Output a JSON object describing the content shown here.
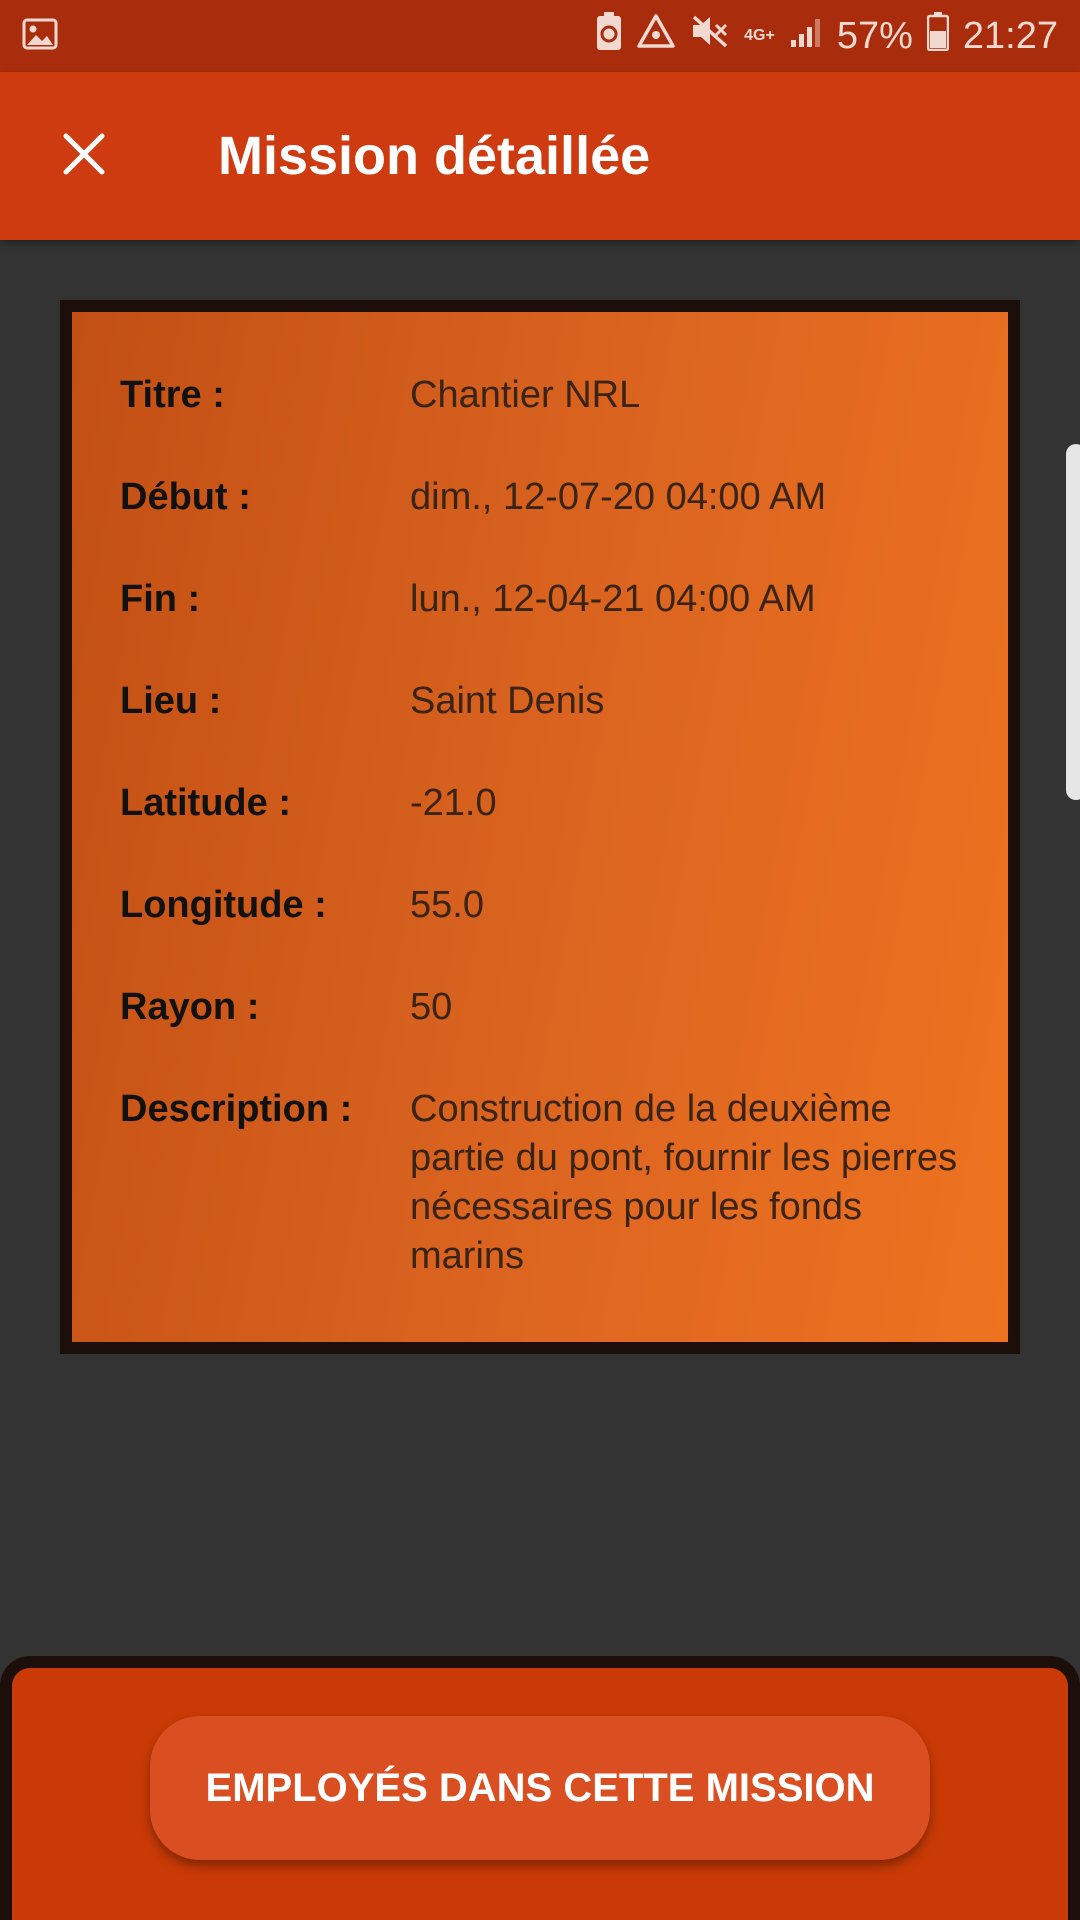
{
  "status_bar": {
    "left_icon": "gallery-icon",
    "network": "4G+",
    "battery_percent": "57%",
    "time": "21:27"
  },
  "app_bar": {
    "title": "Mission détaillée",
    "close_icon": "close-icon"
  },
  "mission": {
    "fields": [
      {
        "label": "Titre :",
        "value": "Chantier NRL"
      },
      {
        "label": "Début :",
        "value": "dim., 12-07-20  04:00 AM"
      },
      {
        "label": "Fin :",
        "value": "lun., 12-04-21  04:00 AM"
      },
      {
        "label": "Lieu :",
        "value": "Saint Denis"
      },
      {
        "label": "Latitude :",
        "value": "-21.0"
      },
      {
        "label": "Longitude :",
        "value": "55.0"
      },
      {
        "label": "Rayon :",
        "value": "50"
      },
      {
        "label": "Description :",
        "value": "Construction de la deuxième partie du pont, fournir les pierres nécessaires pour les fonds marins"
      }
    ]
  },
  "actions": {
    "employees_button": "EMPLOYÉS DANS CETTE MISSION"
  },
  "colors": {
    "status_bar": "#a92d0d",
    "app_bar": "#cf3b10",
    "background": "#333333",
    "card_start": "#c24f14",
    "card_end": "#ee7320",
    "bottom_panel": "#c93a06",
    "button": "#d94f22"
  }
}
